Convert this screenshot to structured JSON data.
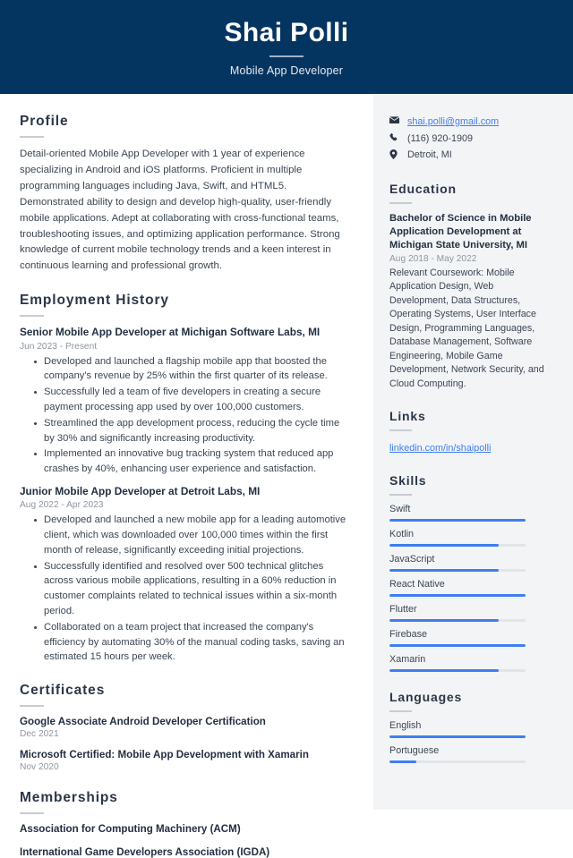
{
  "header": {
    "name": "Shai Polli",
    "job_title": "Mobile App Developer",
    "background_color": "#043460"
  },
  "main": {
    "profile": {
      "heading": "Profile",
      "text": "Detail-oriented Mobile App Developer with 1 year of experience specializing in Android and iOS platforms. Proficient in multiple programming languages including Java, Swift, and HTML5. Demonstrated ability to design and develop high-quality, user-friendly mobile applications. Adept at collaborating with cross-functional teams, troubleshooting issues, and optimizing application performance. Strong knowledge of current mobile technology trends and a keen interest in continuous learning and professional growth."
    },
    "employment": {
      "heading": "Employment History",
      "jobs": [
        {
          "title": "Senior Mobile App Developer at Michigan Software Labs, MI",
          "date": "Jun 2023 - Present",
          "bullets": [
            "Developed and launched a flagship mobile app that boosted the company's revenue by 25% within the first quarter of its release.",
            "Successfully led a team of five developers in creating a secure payment processing app used by over 100,000 customers.",
            "Streamlined the app development process, reducing the cycle time by 30% and significantly increasing productivity.",
            "Implemented an innovative bug tracking system that reduced app crashes by 40%, enhancing user experience and satisfaction."
          ]
        },
        {
          "title": "Junior Mobile App Developer at Detroit Labs, MI",
          "date": "Aug 2022 - Apr 2023",
          "bullets": [
            "Developed and launched a new mobile app for a leading automotive client, which was downloaded over 100,000 times within the first month of release, significantly exceeding initial projections.",
            "Successfully identified and resolved over 500 technical glitches across various mobile applications, resulting in a 60% reduction in customer complaints related to technical issues within a six-month period.",
            "Collaborated on a team project that increased the company's efficiency by automating 30% of the manual coding tasks, saving an estimated 15 hours per week."
          ]
        }
      ]
    },
    "certificates": {
      "heading": "Certificates",
      "items": [
        {
          "name": "Google Associate Android Developer Certification",
          "date": "Dec 2021"
        },
        {
          "name": "Microsoft Certified: Mobile App Development with Xamarin",
          "date": "Nov 2020"
        }
      ]
    },
    "memberships": {
      "heading": "Memberships",
      "items": [
        {
          "name": "Association for Computing Machinery (ACM)"
        },
        {
          "name": "International Game Developers Association (IGDA)"
        }
      ]
    }
  },
  "sidebar": {
    "contact": [
      {
        "icon": "email-icon",
        "value": "shai.polli@gmail.com",
        "is_link": true
      },
      {
        "icon": "phone-icon",
        "value": "(116) 920-1909",
        "is_link": false
      },
      {
        "icon": "location-pin-icon",
        "value": "Detroit, MI",
        "is_link": false
      }
    ],
    "education": {
      "heading": "Education",
      "degree": "Bachelor of Science in Mobile Application Development at Michigan State University, MI",
      "date": "Aug 2018 - May 2022",
      "description": "Relevant Coursework: Mobile Application Design, Web Development, Data Structures, Operating Systems, User Interface Design, Programming Languages, Database Management, Software Engineering, Mobile Game Development, Network Security, and Cloud Computing."
    },
    "links": {
      "heading": "Links",
      "items": [
        {
          "label": "linkedin.com/in/shaipolli"
        }
      ]
    },
    "skills": {
      "heading": "Skills",
      "accent_color": "#3f7ef2",
      "items": [
        {
          "label": "Swift",
          "level": 100
        },
        {
          "label": "Kotlin",
          "level": 80
        },
        {
          "label": "JavaScript",
          "level": 80
        },
        {
          "label": "React Native",
          "level": 100
        },
        {
          "label": "Flutter",
          "level": 80
        },
        {
          "label": "Firebase",
          "level": 100
        },
        {
          "label": "Xamarin",
          "level": 80
        }
      ]
    },
    "languages": {
      "heading": "Languages",
      "items": [
        {
          "label": "English",
          "level": 100
        },
        {
          "label": "Portuguese",
          "level": 20
        }
      ]
    }
  }
}
